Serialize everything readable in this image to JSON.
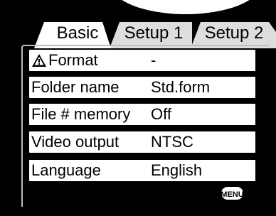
{
  "tabs": [
    {
      "label": "Basic",
      "active": true
    },
    {
      "label": "Setup 1",
      "active": false
    },
    {
      "label": "Setup 2",
      "active": false
    }
  ],
  "menu": {
    "items": [
      {
        "label": "Format",
        "value": "-",
        "icon": "warning-icon"
      },
      {
        "label": "Folder name",
        "value": "Std.form"
      },
      {
        "label": "File # memory",
        "value": "Off"
      },
      {
        "label": "Video output",
        "value": "NTSC"
      },
      {
        "label": "Language",
        "value": "English"
      }
    ]
  },
  "footer": {
    "menu_key_label": "MENU",
    "back_icon": "return-arrow-icon"
  },
  "colors": {
    "background": "#000000",
    "row_background": "#ffffff",
    "text": "#000000",
    "active_tab": "#ffffff",
    "inactive_tab": "#dddddd",
    "panel_border": "#bdbdbd"
  }
}
